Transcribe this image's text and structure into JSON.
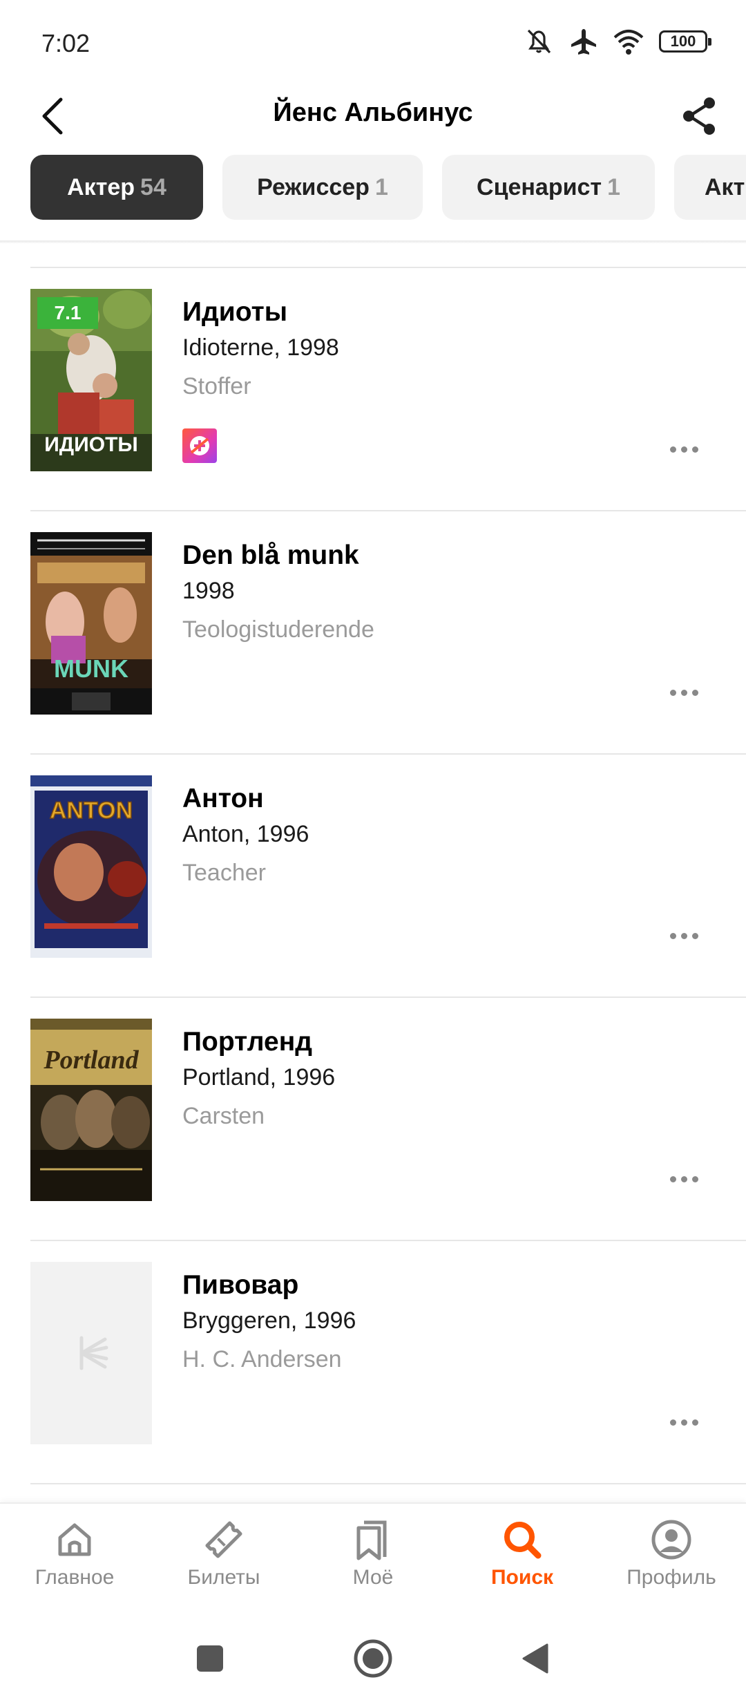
{
  "status_bar": {
    "time": "7:02",
    "battery": "100",
    "icons": [
      "silent-icon",
      "airplane-icon",
      "wifi-icon",
      "battery-icon"
    ]
  },
  "header": {
    "title": "Йенс Альбинус"
  },
  "tabs": [
    {
      "label": "Актер",
      "count": "54",
      "active": true
    },
    {
      "label": "Режиссер",
      "count": "1",
      "active": false
    },
    {
      "label": "Сценарист",
      "count": "1",
      "active": false
    },
    {
      "label": "Акт",
      "count": "",
      "active": false
    }
  ],
  "films": [
    {
      "title": "Идиоты",
      "subtitle": "Idioterne, 1998",
      "role": "Stoffer",
      "rating": "7.1",
      "poster_text": "ИДИОТЫ",
      "has_service_badge": true
    },
    {
      "title": "Den blå munk",
      "subtitle": "1998",
      "role": "Teologistuderende",
      "poster_text": "MUNK"
    },
    {
      "title": "Антон",
      "subtitle": "Anton, 1996",
      "role": "Teacher",
      "poster_text": "ANTON"
    },
    {
      "title": "Портленд",
      "subtitle": "Portland, 1996",
      "role": "Carsten",
      "poster_text": "Portland"
    },
    {
      "title": "Пивовар",
      "subtitle": "Bryggeren, 1996",
      "role": "H. C. Andersen",
      "poster_text": ""
    }
  ],
  "bottom_nav": [
    {
      "label": "Главное",
      "icon": "home-icon",
      "active": false
    },
    {
      "label": "Билеты",
      "icon": "ticket-icon",
      "active": false
    },
    {
      "label": "Моё",
      "icon": "bookmark-icon",
      "active": false
    },
    {
      "label": "Поиск",
      "icon": "search-icon",
      "active": true
    },
    {
      "label": "Профиль",
      "icon": "profile-icon",
      "active": false
    }
  ],
  "colors": {
    "accent": "#ff5500",
    "rating_green": "#3bb33b",
    "active_tab": "#333333"
  }
}
